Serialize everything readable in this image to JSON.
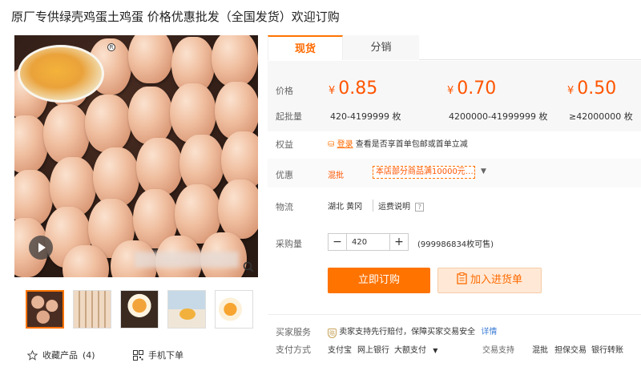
{
  "title": "原厂专供绿壳鸡蛋土鸡蛋 价格优惠批发（全国发货）欢迎订购",
  "tabs": {
    "active": "现货",
    "other": "分销"
  },
  "price_label": "价格",
  "moq_label": "起批量",
  "currency": "¥",
  "tiers": [
    {
      "price": "0.85",
      "qty": "420-4199999 枚"
    },
    {
      "price": "0.70",
      "qty": "4200000-41999999 枚"
    },
    {
      "price": "0.50",
      "qty": "≥42000000 枚"
    }
  ],
  "rights": {
    "label": "权益",
    "link": "登录",
    "text": "查看是否享首单包邮或首单立减"
  },
  "promo": {
    "label": "优惠",
    "type": "混批",
    "tag": "本店部分商品满10000元…"
  },
  "logistics": {
    "label": "物流",
    "origin": "湖北 黄冈",
    "info": "运费说明",
    "help": "?"
  },
  "purchase": {
    "label": "采购量",
    "value": "420",
    "minus": "−",
    "plus": "+",
    "stock": "(999986834枚可售)"
  },
  "buttons": {
    "buy": "立即订购",
    "cart": "加入进货单"
  },
  "buyer_service": {
    "label": "买家服务",
    "text": "卖家支持先行赔付，保障买家交易安全",
    "link": "详情"
  },
  "payment": {
    "label": "支付方式",
    "methods": [
      "支付宝",
      "网上银行",
      "大额支付"
    ],
    "trade_label": "交易支持",
    "trade": [
      "混批",
      "担保交易",
      "银行转账"
    ]
  },
  "favorites": {
    "label": "收藏产品",
    "count": "(4)"
  },
  "mobile": {
    "label": "手机下单"
  },
  "colors": {
    "accent": "#ff7300",
    "price": "#ff5500"
  }
}
